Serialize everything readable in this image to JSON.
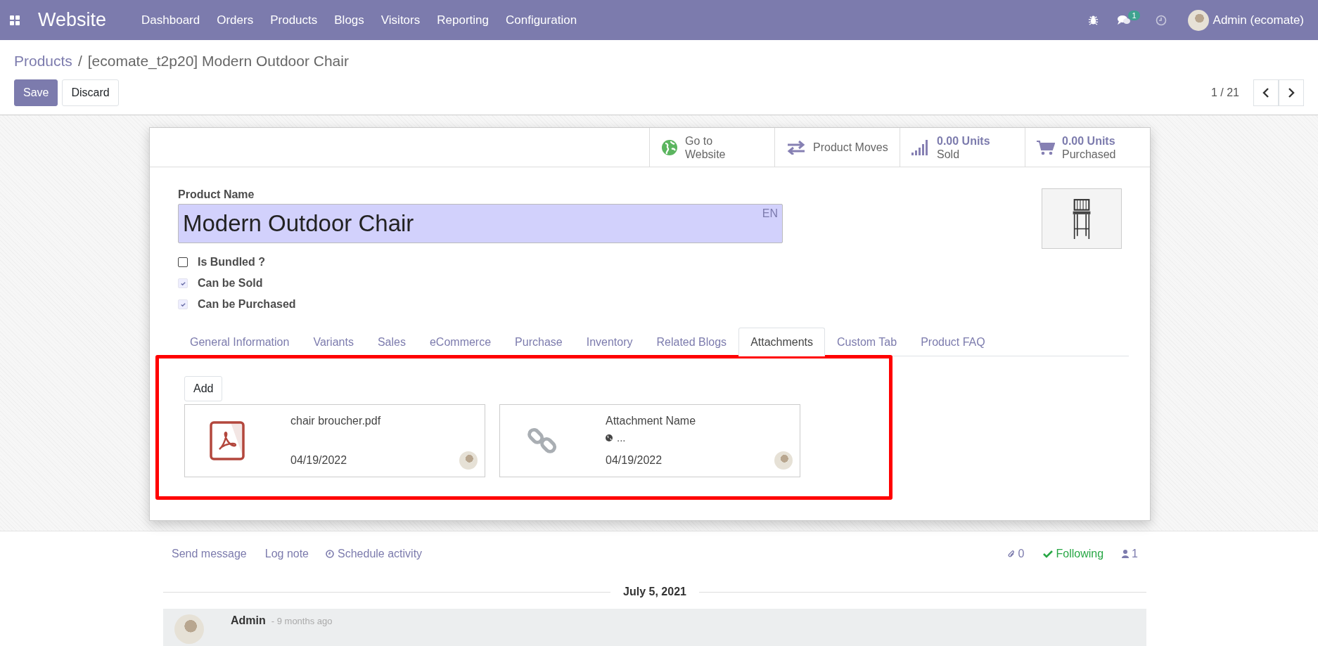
{
  "navbar": {
    "app_name": "Website",
    "menu": [
      "Dashboard",
      "Orders",
      "Products",
      "Blogs",
      "Visitors",
      "Reporting",
      "Configuration"
    ],
    "message_count": "1",
    "user": "Admin (ecomate)"
  },
  "breadcrumb": {
    "parent": "Products",
    "separator": "/",
    "current": "[ecomate_t2p20] Modern Outdoor Chair"
  },
  "actions": {
    "save": "Save",
    "discard": "Discard"
  },
  "pager": {
    "value": "1 / 21"
  },
  "stat_buttons": [
    {
      "kind": "website",
      "value": "Go to",
      "label": "Website"
    },
    {
      "kind": "moves",
      "label": "Product Moves"
    },
    {
      "kind": "sold",
      "value": "0.00 Units",
      "label": "Sold"
    },
    {
      "kind": "purchased",
      "value": "0.00 Units",
      "label": "Purchased"
    }
  ],
  "product": {
    "label": "Product Name",
    "name": "Modern Outdoor Chair",
    "lang": "EN"
  },
  "options": [
    {
      "label": "Is Bundled ?",
      "checked": false
    },
    {
      "label": "Can be Sold",
      "checked": true
    },
    {
      "label": "Can be Purchased",
      "checked": true
    }
  ],
  "tabs": [
    {
      "label": "General Information",
      "selected": false
    },
    {
      "label": "Variants",
      "selected": false
    },
    {
      "label": "Sales",
      "selected": false
    },
    {
      "label": "eCommerce",
      "selected": false
    },
    {
      "label": "Purchase",
      "selected": false
    },
    {
      "label": "Inventory",
      "selected": false
    },
    {
      "label": "Related Blogs",
      "selected": false
    },
    {
      "label": "Attachments",
      "selected": true
    },
    {
      "label": "Custom Tab",
      "selected": false
    },
    {
      "label": "Product FAQ",
      "selected": false
    }
  ],
  "attachments": {
    "add": "Add",
    "items": [
      {
        "kind": "pdf",
        "name": "chair broucher.pdf",
        "date": "04/19/2022"
      },
      {
        "kind": "link",
        "name": "Attachment Name",
        "url": "...",
        "date": "04/19/2022"
      }
    ]
  },
  "chatter": {
    "send": "Send message",
    "log": "Log note",
    "schedule": "Schedule activity",
    "attachments_count": "0",
    "follow": "Following",
    "followers": "1",
    "date": "July 5, 2021",
    "message": {
      "author": "Admin",
      "time": "- 9 months ago"
    }
  }
}
